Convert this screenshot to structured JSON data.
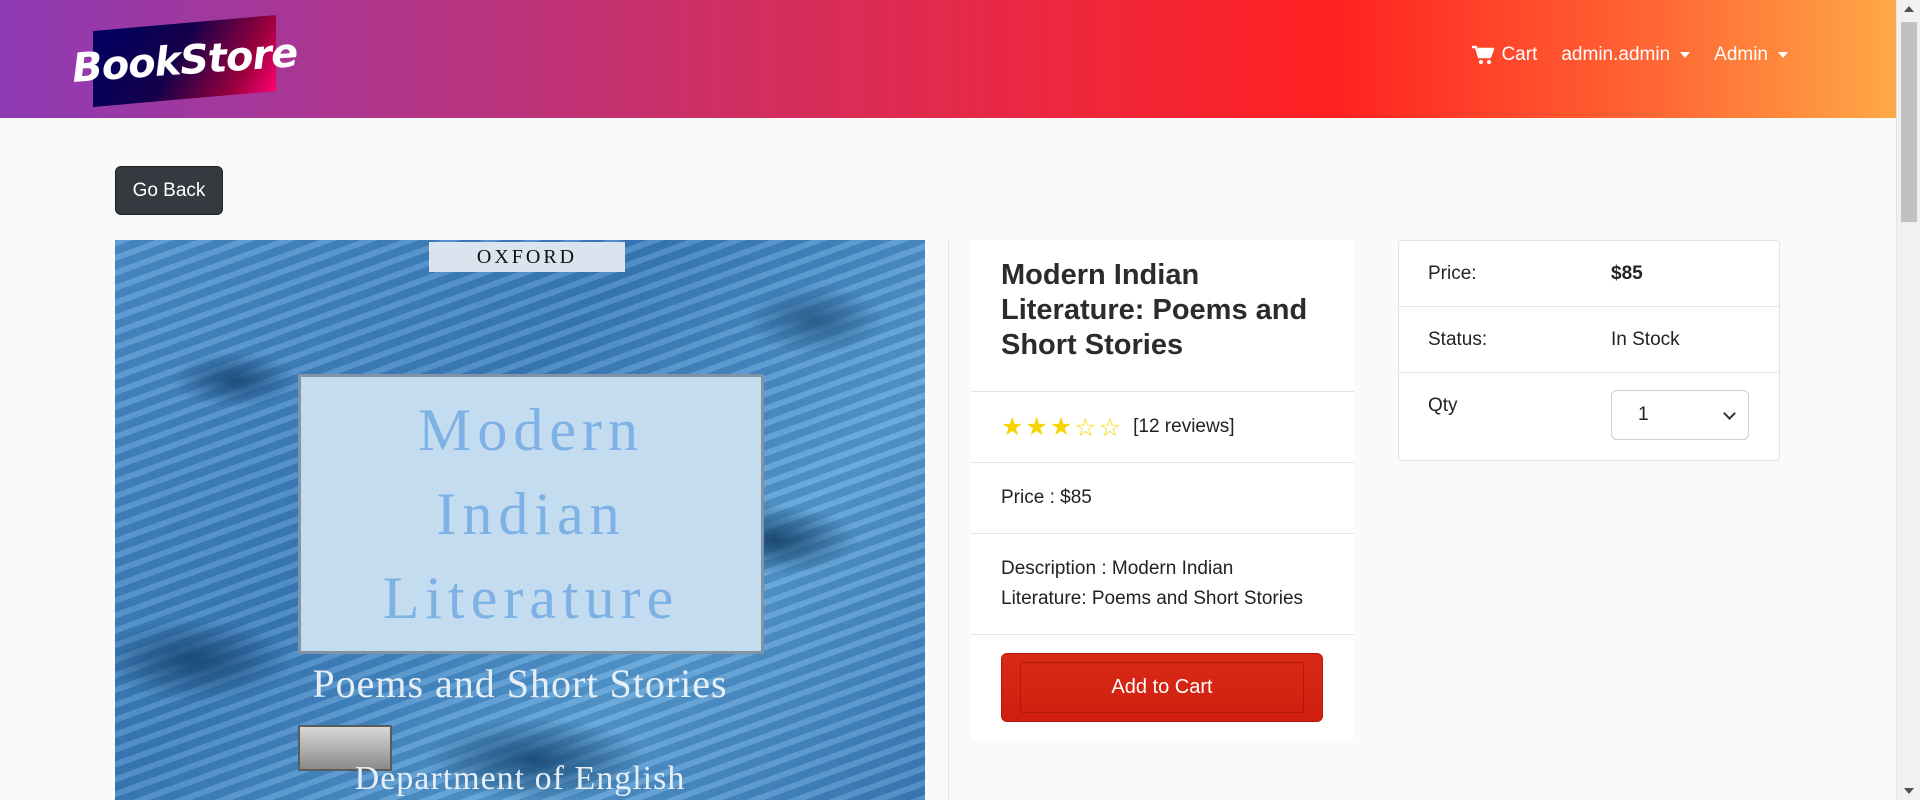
{
  "navbar": {
    "brand": "BookStore",
    "cart_label": "Cart",
    "user_label": "admin.admin",
    "admin_label": "Admin"
  },
  "go_back_label": "Go Back",
  "cover": {
    "publisher": "OXFORD",
    "title_lines": [
      "Modern",
      "Indian",
      "Literature"
    ],
    "subtitle": "Poems and Short Stories",
    "department": "Department of English"
  },
  "product": {
    "title": "Modern Indian Literature: Poems and Short Stories",
    "rating": 3,
    "rating_max": 5,
    "reviews_text": "[12 reviews]",
    "price_text": "Price : $85",
    "description_text": "Description : Modern Indian Literature: Poems and Short Stories",
    "add_to_cart_label": "Add to Cart"
  },
  "summary": {
    "price_label": "Price:",
    "price_value": "$85",
    "status_label": "Status:",
    "status_value": "In Stock",
    "qty_label": "Qty",
    "qty_value": "1"
  },
  "colors": {
    "star": "#f5d400",
    "add_to_cart": "#d92a16",
    "go_back": "#343a40"
  }
}
